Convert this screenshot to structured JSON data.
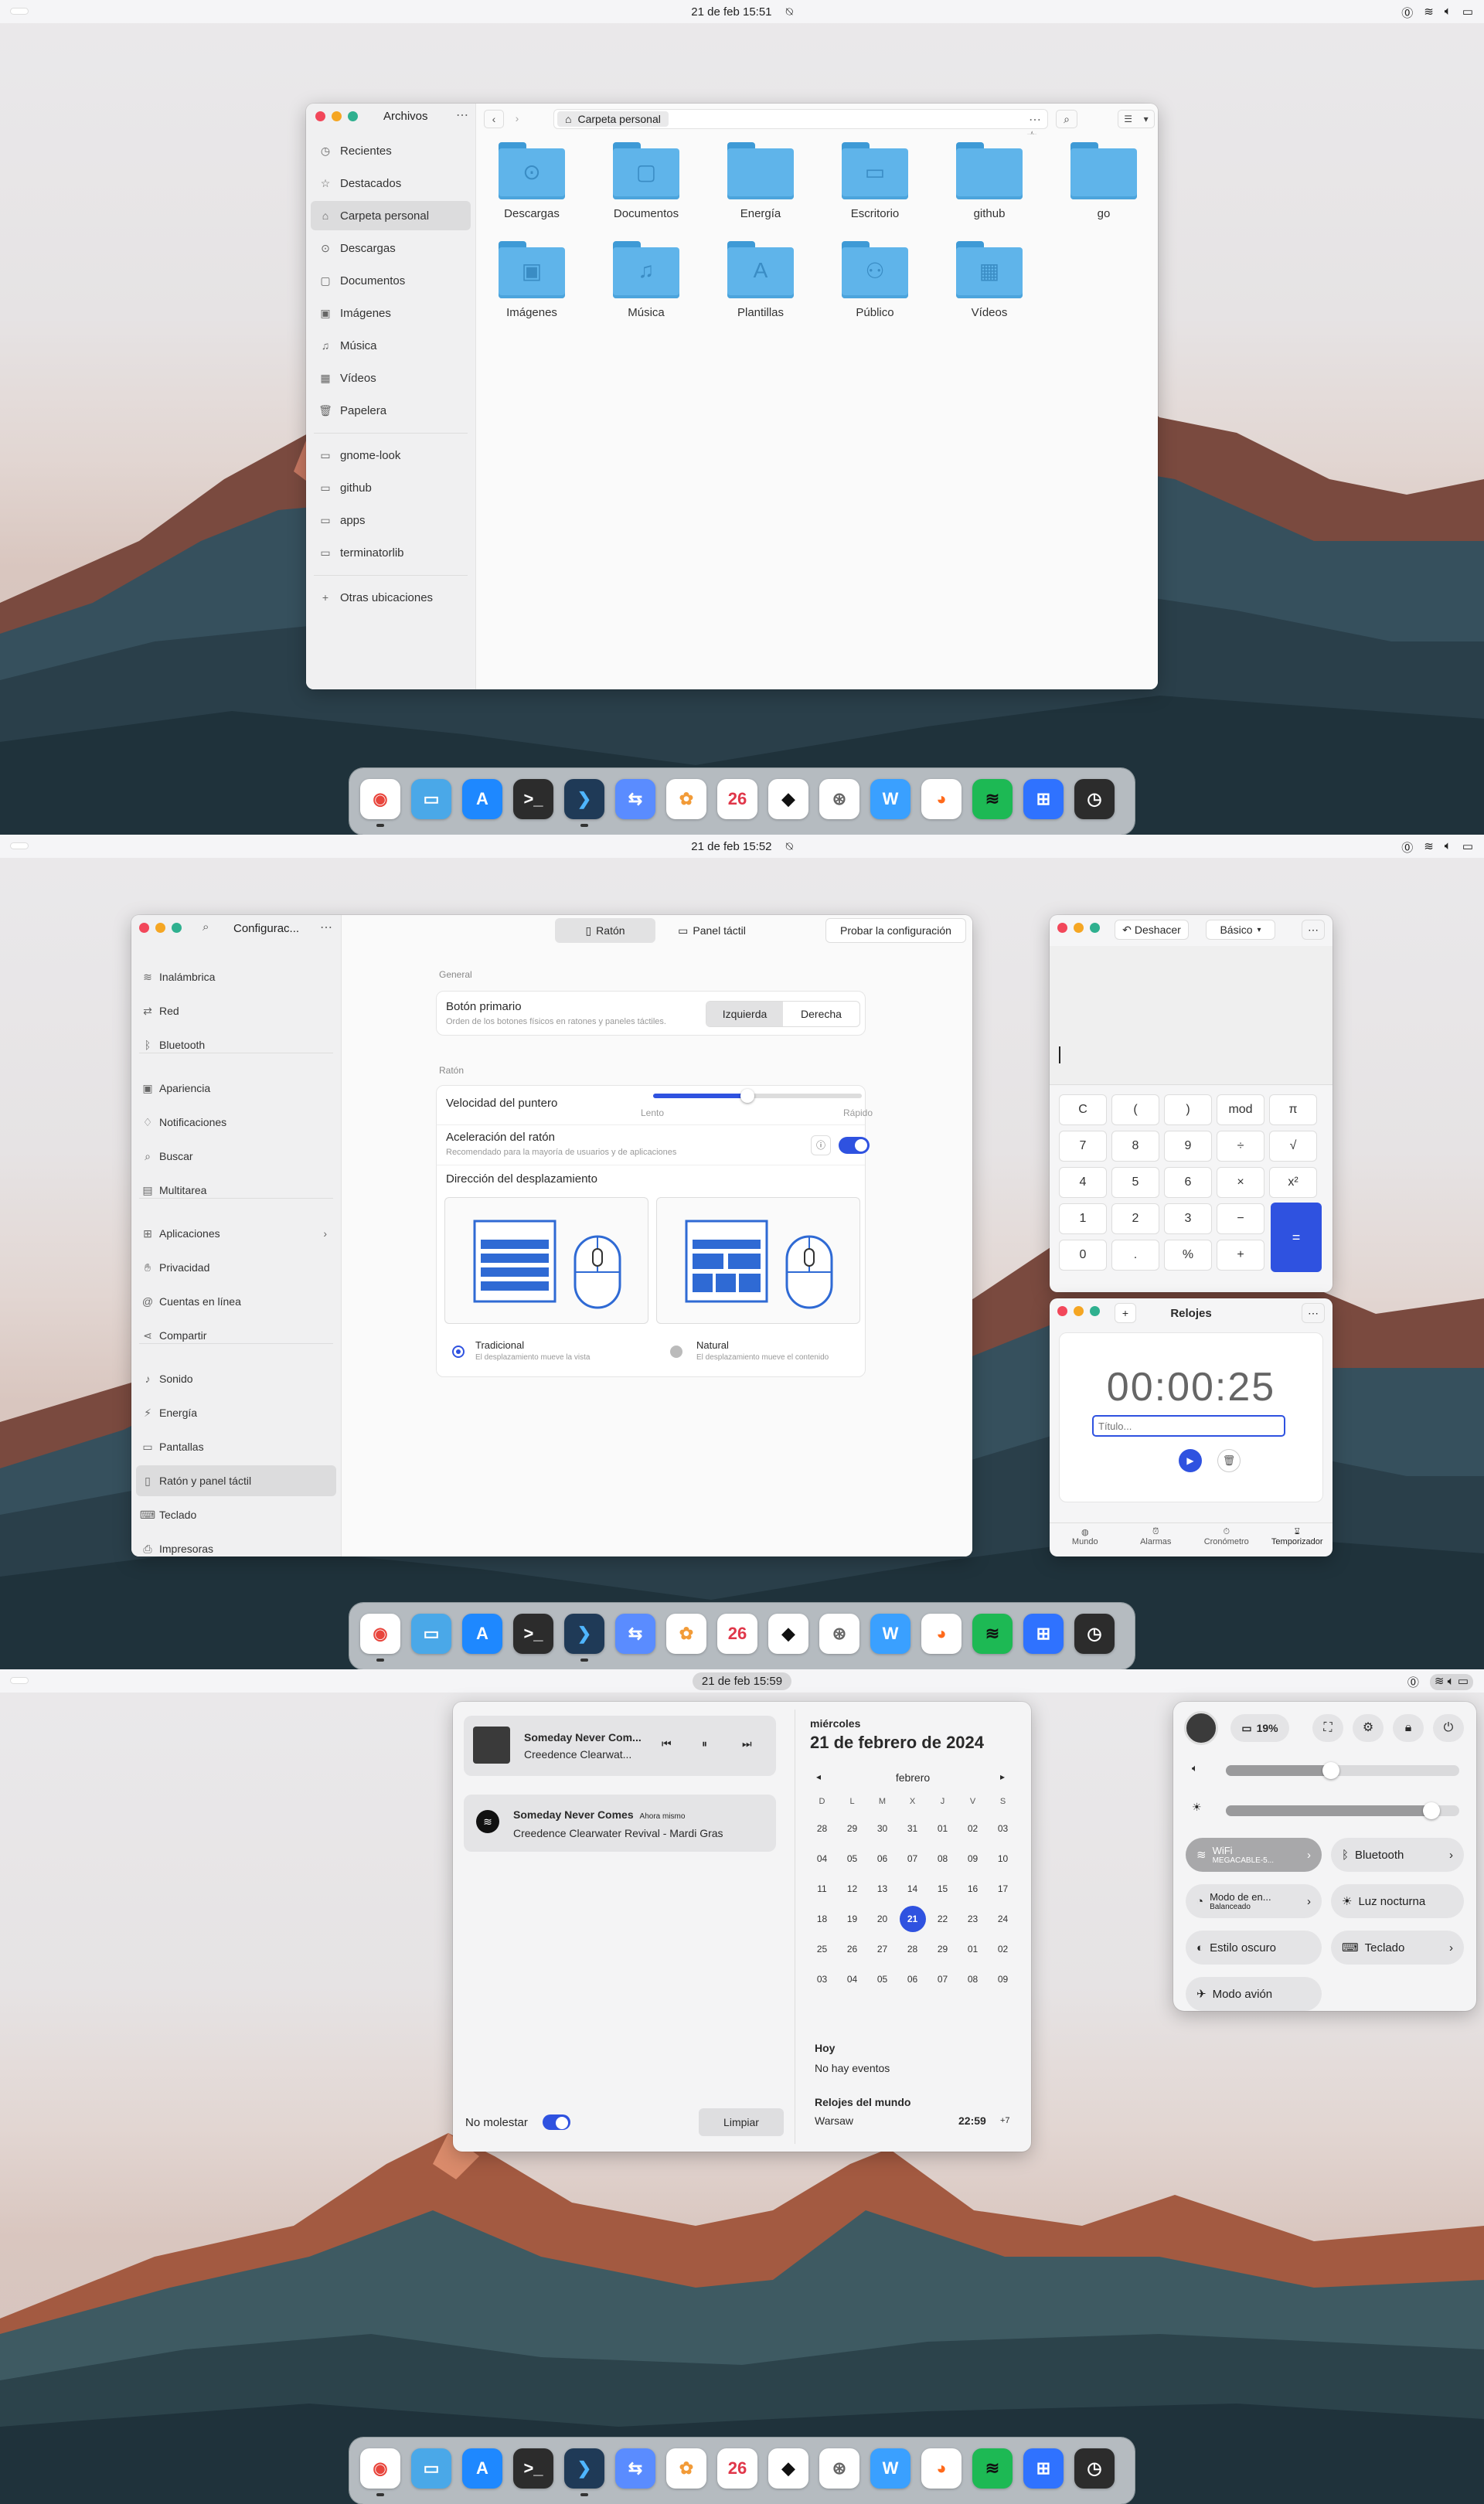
{
  "screen1": {
    "topbar": {
      "clock": "21 de feb  15:51"
    },
    "files": {
      "title": "Archivos",
      "path": "Carpeta personal",
      "sidebar": [
        {
          "label": "Recientes",
          "icon": "clock-icon"
        },
        {
          "label": "Destacados",
          "icon": "star-icon"
        },
        {
          "label": "Carpeta personal",
          "icon": "home-icon",
          "selected": true
        },
        {
          "label": "Descargas",
          "icon": "download-icon"
        },
        {
          "label": "Documentos",
          "icon": "document-icon"
        },
        {
          "label": "Imágenes",
          "icon": "image-icon"
        },
        {
          "label": "Música",
          "icon": "music-icon"
        },
        {
          "label": "Vídeos",
          "icon": "video-icon"
        },
        {
          "label": "Papelera",
          "icon": "trash-icon"
        }
      ],
      "bookmarks": [
        "gnome-look",
        "github",
        "apps",
        "terminatorlib"
      ],
      "other": "Otras ubicaciones",
      "folders": [
        "Descargas",
        "Documentos",
        "Energía",
        "Escritorio",
        "github",
        "go",
        "Imágenes",
        "Música",
        "Plantillas",
        "Público",
        "Vídeos"
      ]
    }
  },
  "screen2": {
    "topbar": {
      "clock": "21 de feb  15:52"
    },
    "settings": {
      "title": "Configurac...",
      "tabs": [
        "Ratón",
        "Panel táctil"
      ],
      "test_button": "Probar la configuración",
      "sidebar": [
        "Inalámbrica",
        "Red",
        "Bluetooth",
        "Apariencia",
        "Notificaciones",
        "Buscar",
        "Multitarea",
        "Aplicaciones",
        "Privacidad",
        "Cuentas en línea",
        "Compartir",
        "Sonido",
        "Energía",
        "Pantallas",
        "Ratón y panel táctil",
        "Teclado",
        "Impresoras"
      ],
      "general_heading": "General",
      "primary_button_label": "Botón primario",
      "primary_button_desc": "Orden de los botones físicos en ratones y paneles táctiles.",
      "left": "Izquierda",
      "right": "Derecha",
      "mouse_heading": "Ratón",
      "speed_label": "Velocidad del puntero",
      "speed_slow": "Lento",
      "speed_fast": "Rápido",
      "speed_value": 0.45,
      "accel_label": "Aceleración del ratón",
      "accel_desc": "Recomendado para la mayoría de usuarios y de aplicaciones",
      "scroll_heading": "Dirección del desplazamiento",
      "traditional": "Tradicional",
      "traditional_desc": "El desplazamiento mueve la vista",
      "natural": "Natural",
      "natural_desc": "El desplazamiento mueve el contenido"
    },
    "calculator": {
      "undo": "Deshacer",
      "mode": "Básico",
      "keys": [
        "C",
        "(",
        ")",
        "mod",
        "π",
        "7",
        "8",
        "9",
        "÷",
        "√",
        "4",
        "5",
        "6",
        "×",
        "x²",
        "1",
        "2",
        "3",
        "−",
        "0",
        ".",
        "%",
        "+"
      ],
      "equals": "="
    },
    "clocks": {
      "title": "Relojes",
      "time": "00:00:25",
      "placeholder": "Título...",
      "nav": [
        "Mundo",
        "Alarmas",
        "Cronómetro",
        "Temporizador"
      ]
    }
  },
  "screen3": {
    "topbar": {
      "clock": "21 de feb  15:59"
    },
    "media": {
      "title": "Someday Never Com...",
      "artist": "Creedence Clearwat..."
    },
    "notification": {
      "title": "Someday Never Comes",
      "time": "Ahora mismo",
      "body": "Creedence Clearwater Revival - Mardi Gras"
    },
    "dnd_label": "No molestar",
    "clear_label": "Limpiar",
    "calendar": {
      "weekday": "miércoles",
      "date": "21 de febrero de 2024",
      "month": "febrero",
      "dow": [
        "D",
        "L",
        "M",
        "X",
        "J",
        "V",
        "S"
      ],
      "weeks": [
        [
          "28",
          "29",
          "30",
          "31",
          "01",
          "02",
          "03"
        ],
        [
          "04",
          "05",
          "06",
          "07",
          "08",
          "09",
          "10"
        ],
        [
          "11",
          "12",
          "13",
          "14",
          "15",
          "16",
          "17"
        ],
        [
          "18",
          "19",
          "20",
          "21",
          "22",
          "23",
          "24"
        ],
        [
          "25",
          "26",
          "27",
          "28",
          "29",
          "01",
          "02"
        ],
        [
          "03",
          "04",
          "05",
          "06",
          "07",
          "08",
          "09"
        ]
      ],
      "today": "21",
      "today_heading": "Hoy",
      "no_events": "No hay eventos",
      "world_heading": "Relojes del mundo",
      "city": "Warsaw",
      "city_time": "22:59",
      "city_offset": "+7"
    },
    "quick": {
      "battery": "19%",
      "volume": 0.45,
      "brightness": 0.88,
      "wifi": "WiFi",
      "wifi_sub": "MEGACABLE-5...",
      "bluetooth": "Bluetooth",
      "power_mode": "Modo de en...",
      "power_sub": "Balanceado",
      "night": "Luz nocturna",
      "dark": "Estilo oscuro",
      "keyboard": "Teclado",
      "airplane": "Modo avión"
    }
  },
  "dock": {
    "apps": [
      {
        "name": "chrome",
        "glyph": "◉",
        "bg": "#ffffff",
        "fg": "#e8453c"
      },
      {
        "name": "files",
        "glyph": "▭",
        "bg": "#4aa8e8",
        "fg": "#ffffff"
      },
      {
        "name": "app-store",
        "glyph": "A",
        "bg": "#1e88ff",
        "fg": "#ffffff"
      },
      {
        "name": "terminal",
        "glyph": ">_",
        "bg": "#2c2c2c",
        "fg": "#ffffff"
      },
      {
        "name": "vscode",
        "glyph": "❯",
        "bg": "#1f3a57",
        "fg": "#4fb6ff"
      },
      {
        "name": "settings",
        "glyph": "⇆",
        "bg": "#5a8cff",
        "fg": "#ffffff"
      },
      {
        "name": "photos",
        "glyph": "✿",
        "bg": "#ffffff",
        "fg": "#f29b38"
      },
      {
        "name": "calendar",
        "glyph": "26",
        "bg": "#ffffff",
        "fg": "#e0374a"
      },
      {
        "name": "inkscape",
        "glyph": "◆",
        "bg": "#ffffff",
        "fg": "#111111"
      },
      {
        "name": "steam",
        "glyph": "⊛",
        "bg": "#ffffff",
        "fg": "#666666"
      },
      {
        "name": "writer",
        "glyph": "W",
        "bg": "#3aa0ff",
        "fg": "#ffffff"
      },
      {
        "name": "firefox",
        "glyph": "◕",
        "bg": "#ffffff",
        "fg": "#ff6a1b"
      },
      {
        "name": "spotify",
        "glyph": "≋",
        "bg": "#1db954",
        "fg": "#111111"
      },
      {
        "name": "calculator",
        "glyph": "⊞",
        "bg": "#2f72ff",
        "fg": "#ffffff"
      },
      {
        "name": "clock",
        "glyph": "◷",
        "bg": "#2c2c2c",
        "fg": "#ffffff"
      }
    ]
  }
}
